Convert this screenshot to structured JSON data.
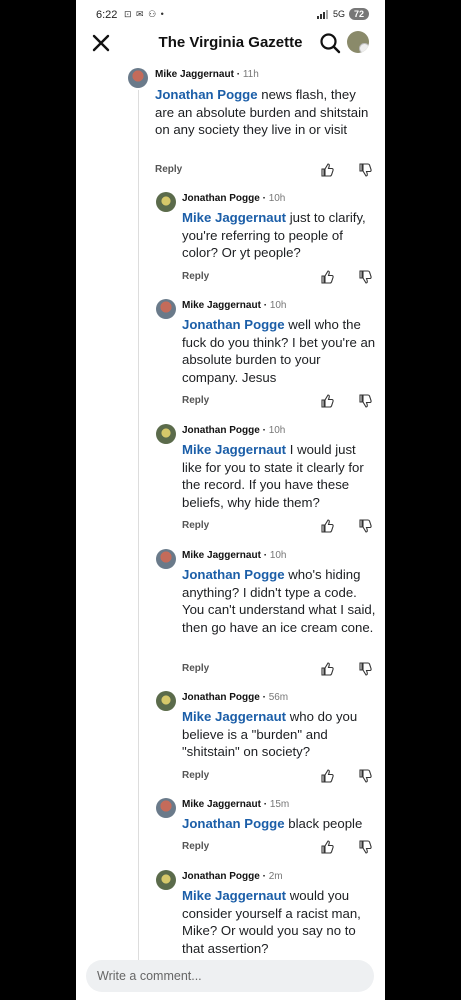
{
  "status_bar": {
    "time": "6:22",
    "icons": "⊡ ✉ ⚇ •",
    "network": "5G",
    "battery": "72"
  },
  "header": {
    "title": "The Virginia Gazette"
  },
  "comments": [
    {
      "author": "Mike Jaggernaut",
      "time": "11h",
      "mention": "Jonathan Pogge",
      "text": "news flash, they are an absolute burden and shitstain on any society they live in or visit",
      "reply": "Reply"
    },
    {
      "author": "Jonathan Pogge",
      "time": "10h",
      "mention": "Mike Jaggernaut",
      "text": "just to clarify, you're referring to people of color? Or yt people?",
      "reply": "Reply"
    },
    {
      "author": "Mike Jaggernaut",
      "time": "10h",
      "mention": "Jonathan Pogge",
      "text": "well who the fuck do you think?  I bet you're an absolute burden to your company. Jesus",
      "reply": "Reply"
    },
    {
      "author": "Jonathan Pogge",
      "time": "10h",
      "mention": "Mike Jaggernaut",
      "text": "I would just like for you to state it clearly for the record. If you have these beliefs, why hide them?",
      "reply": "Reply"
    },
    {
      "author": "Mike Jaggernaut",
      "time": "10h",
      "mention": "Jonathan Pogge",
      "text": "who's hiding anything? I didn't type a code. You can't understand what I said, then go have an ice cream cone.",
      "reply": "Reply"
    },
    {
      "author": "Jonathan Pogge",
      "time": "56m",
      "mention": "Mike Jaggernaut",
      "text": "who do you believe is a \"burden\" and \"shitstain\" on society?",
      "reply": "Reply"
    },
    {
      "author": "Mike Jaggernaut",
      "time": "15m",
      "mention": "Jonathan Pogge",
      "text": "black people",
      "reply": "Reply"
    },
    {
      "author": "Jonathan Pogge",
      "time": "2m",
      "mention": "Mike Jaggernaut",
      "text": "would you consider yourself a racist man, Mike? Or would you say no to that assertion?",
      "reply": ""
    }
  ],
  "composer": {
    "placeholder": "Write a comment..."
  }
}
